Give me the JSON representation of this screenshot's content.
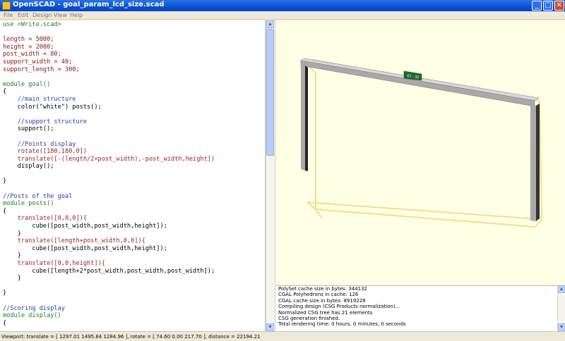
{
  "window": {
    "title": "OpenSCAD - goal_param_lcd_size.scad",
    "minimize": "_",
    "maximize": "□",
    "close": "✕"
  },
  "menu": [
    "File",
    "Edit",
    "Design",
    "View",
    "Help"
  ],
  "editor": {
    "lines": [
      "use <Write.scad>",
      "",
      "length = 5000;",
      "height = 2000;",
      "post_width = 80;",
      "support_width = 40;",
      "support_length = 300;",
      "",
      "module goal()",
      "{",
      "    //main structure",
      "    color(\"white\") posts();",
      "",
      "    //support structure",
      "    support();",
      "",
      "    //Points display",
      "    rotate([180,180,0])",
      "    translate([-(length/2+post_width),-post_width,height])",
      "    display();",
      "",
      "}",
      "",
      "//Posts of the goal",
      "module posts()",
      "{",
      "    translate([0,0,0]){",
      "        cube([post_width,post_width,height]);",
      "    }",
      "    translate([length+post_width,0,0]){",
      "        cube([post_width,post_width,height]);",
      "    }",
      "    translate([0,0,height]){",
      "        cube([length+2*post_width,post_width,post_width]);",
      "    }",
      "",
      "}",
      "",
      "//Scoring display",
      "module display()",
      "{"
    ]
  },
  "viewport": {
    "display_label": "42 - 35",
    "background": "#ffffe5",
    "support_color": "#f5dd8c",
    "post_color": "#a9a9a9"
  },
  "console": {
    "lines": [
      "PolySet cache size in bytes: 344132",
      "CGAL Polyhedrons in cache: 126",
      "CGAL cache size in bytes: 8919228",
      "Compiling design (CSG Products normalization)...",
      "Normalized CSG tree has 21 elements",
      "CSG generation finished.",
      "Total rendering time: 0 hours, 0 minutes, 0 seconds"
    ]
  },
  "status": {
    "text": "Viewport: translate = [ 1297.01 1495.84 1284.96 ], rotate = [ 74.60 0.00 217.70 ], distance = 22194.21"
  }
}
